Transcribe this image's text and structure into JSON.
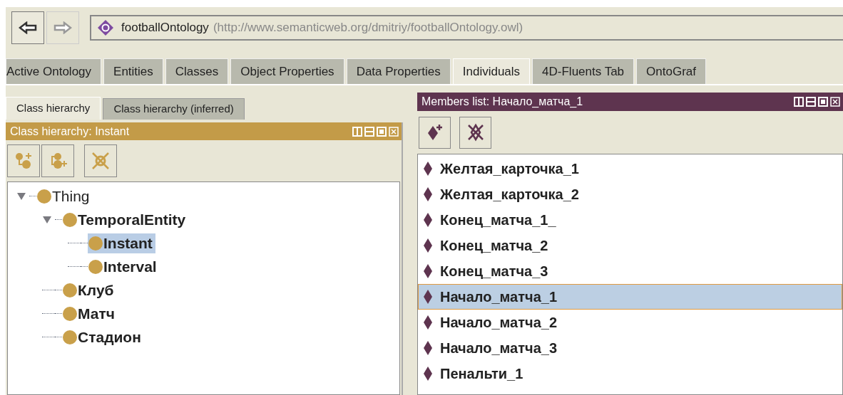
{
  "navigation": {
    "back_enabled": true,
    "forward_enabled": false
  },
  "address": {
    "name": "footballOntology",
    "iri": "(http://www.semanticweb.org/dmitriy/footballOntology.owl)"
  },
  "tabs": [
    {
      "label": "Active Ontology",
      "selected": false
    },
    {
      "label": "Entities",
      "selected": false
    },
    {
      "label": "Classes",
      "selected": false
    },
    {
      "label": "Object Properties",
      "selected": false
    },
    {
      "label": "Data Properties",
      "selected": false
    },
    {
      "label": "Individuals",
      "selected": true
    },
    {
      "label": "4D-Fluents Tab",
      "selected": false
    },
    {
      "label": "OntoGraf",
      "selected": false
    }
  ],
  "left_panel": {
    "tabs": [
      {
        "label": "Class hierarchy",
        "selected": true
      },
      {
        "label": "Class hierarchy (inferred)",
        "selected": false
      }
    ],
    "title": "Class hierarchy: Instant",
    "tree": [
      {
        "label": "Thing",
        "bold": false,
        "selected": false,
        "expanded": true,
        "children": [
          {
            "label": "TemporalEntity",
            "bold": true,
            "selected": false,
            "expanded": true,
            "children": [
              {
                "label": "Instant",
                "bold": true,
                "selected": true
              },
              {
                "label": "Interval",
                "bold": true,
                "selected": false
              }
            ]
          },
          {
            "label": "Клуб",
            "bold": true,
            "selected": false
          },
          {
            "label": "Матч",
            "bold": true,
            "selected": false
          },
          {
            "label": "Стадион",
            "bold": true,
            "selected": false
          }
        ]
      }
    ]
  },
  "right_panel": {
    "title": "Members list: Начало_матча_1",
    "members": [
      {
        "label": "Желтая_карточка_1",
        "selected": false
      },
      {
        "label": "Желтая_карточка_2",
        "selected": false
      },
      {
        "label": "Конец_матча_1_",
        "selected": false
      },
      {
        "label": "Конец_матча_2",
        "selected": false
      },
      {
        "label": "Конец_матча_3",
        "selected": false
      },
      {
        "label": "Начало_матча_1",
        "selected": true
      },
      {
        "label": "Начало_матча_2",
        "selected": false
      },
      {
        "label": "Начало_матча_3",
        "selected": false
      },
      {
        "label": "Пенальти_1",
        "selected": false
      }
    ]
  }
}
